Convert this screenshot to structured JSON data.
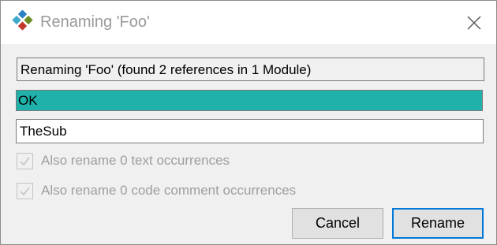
{
  "window": {
    "title": "Renaming 'Foo'"
  },
  "icons": {
    "app": "rubberduck-logo-icon",
    "close": "close-icon",
    "check": "checkmark-icon"
  },
  "dialog": {
    "status_text": "Renaming 'Foo' (found 2 references in 1 Module)",
    "validation_text": "OK",
    "new_name_value": "TheSub",
    "rename_text_occurrences_label": "Also rename 0 text occurrences",
    "rename_text_occurrences_checked": true,
    "rename_comment_occurrences_label": "Also rename 0 code comment occurrences",
    "rename_comment_occurrences_checked": true,
    "cancel_label": "Cancel",
    "rename_label": "Rename"
  },
  "colors": {
    "validation_ok": "#20b2aa",
    "default_button_border": "#0078d7",
    "disabled_text": "#9e9e9e"
  }
}
